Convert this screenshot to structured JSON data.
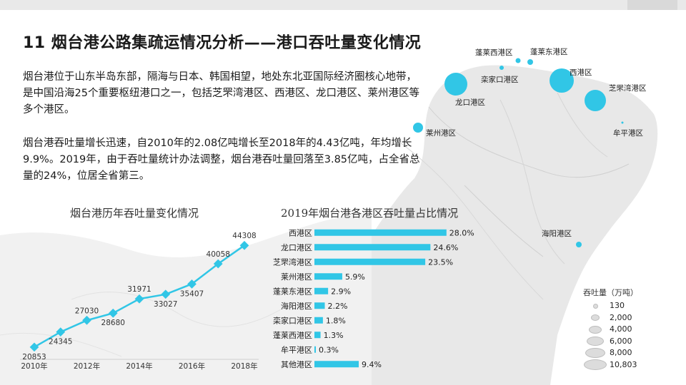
{
  "page": {
    "title": "11 烟台港公路集疏运情况分析——港口吞吐量变化情况",
    "paragraphs": [
      "烟台港位于山东半岛东部，隔海与日本、韩国相望，地处东北亚国际经济圈核心地带，是中国沿海25个重要枢纽港口之一，包括芝罘湾港区、西港区、龙口港区、莱州港区等多个港区。",
      "烟台港吞吐量增长迅速，自2010年的2.08亿吨增长至2018年的4.43亿吨，年均增长9.9%。2019年，由于吞吐量统计办法调整，烟台港吞吐量回落至3.85亿吨，占全省总量的24%，位居全省第三。"
    ]
  },
  "colors": {
    "accent": "#31c6e6",
    "text": "#1a1a1a",
    "map": "#e6e6e6",
    "legend_dot": "#dcdcdc"
  },
  "chart_data": [
    {
      "type": "line",
      "title": "烟台港历年吞吐量变化情况",
      "x": [
        2010,
        2011,
        2012,
        2013,
        2014,
        2015,
        2016,
        2017,
        2018
      ],
      "values": [
        20853,
        24345,
        27030,
        28680,
        31971,
        33027,
        35407,
        40058,
        44308
      ],
      "tick_labels": [
        "2010年",
        "2012年",
        "2014年",
        "2016年",
        "2018年"
      ],
      "tick_years": [
        2010,
        2012,
        2014,
        2016,
        2018
      ],
      "label_positions": [
        "below",
        "below",
        "above",
        "below",
        "above",
        "below",
        "below",
        "above",
        "above"
      ],
      "grid": false
    },
    {
      "type": "bar",
      "title": "2019年烟台港各港区吞吐量占比情况",
      "categories": [
        "西港区",
        "龙口港区",
        "芝罘湾港区",
        "莱州港区",
        "蓬莱东港区",
        "海阳港区",
        "栾家口港区",
        "蓬莱西港区",
        "牟平港区",
        "其他港区"
      ],
      "values": [
        28.0,
        24.6,
        23.5,
        5.9,
        2.9,
        2.2,
        1.8,
        1.3,
        0.3,
        9.4
      ],
      "value_labels": [
        "28.0%",
        "24.6%",
        "23.5%",
        "5.9%",
        "2.9%",
        "2.2%",
        "1.8%",
        "1.3%",
        "0.3%",
        "9.4%"
      ],
      "orientation": "horizontal",
      "xlim": [
        0,
        30
      ]
    }
  ],
  "map": {
    "ports": [
      {
        "name": "蓬莱西港区",
        "size": "small"
      },
      {
        "name": "蓬莱东港区",
        "size": "small"
      },
      {
        "name": "栾家口港区",
        "size": "small"
      },
      {
        "name": "西港区",
        "size": "large"
      },
      {
        "name": "芝罘湾港区",
        "size": "large"
      },
      {
        "name": "龙口港区",
        "size": "large"
      },
      {
        "name": "莱州港区",
        "size": "medium"
      },
      {
        "name": "牟平港区",
        "size": "tiny"
      },
      {
        "name": "海阳港区",
        "size": "small"
      }
    ],
    "legend": {
      "title": "吞吐量（万吨）",
      "values": [
        "130",
        "2,000",
        "4,000",
        "6,000",
        "8,000",
        "10,803"
      ]
    }
  }
}
